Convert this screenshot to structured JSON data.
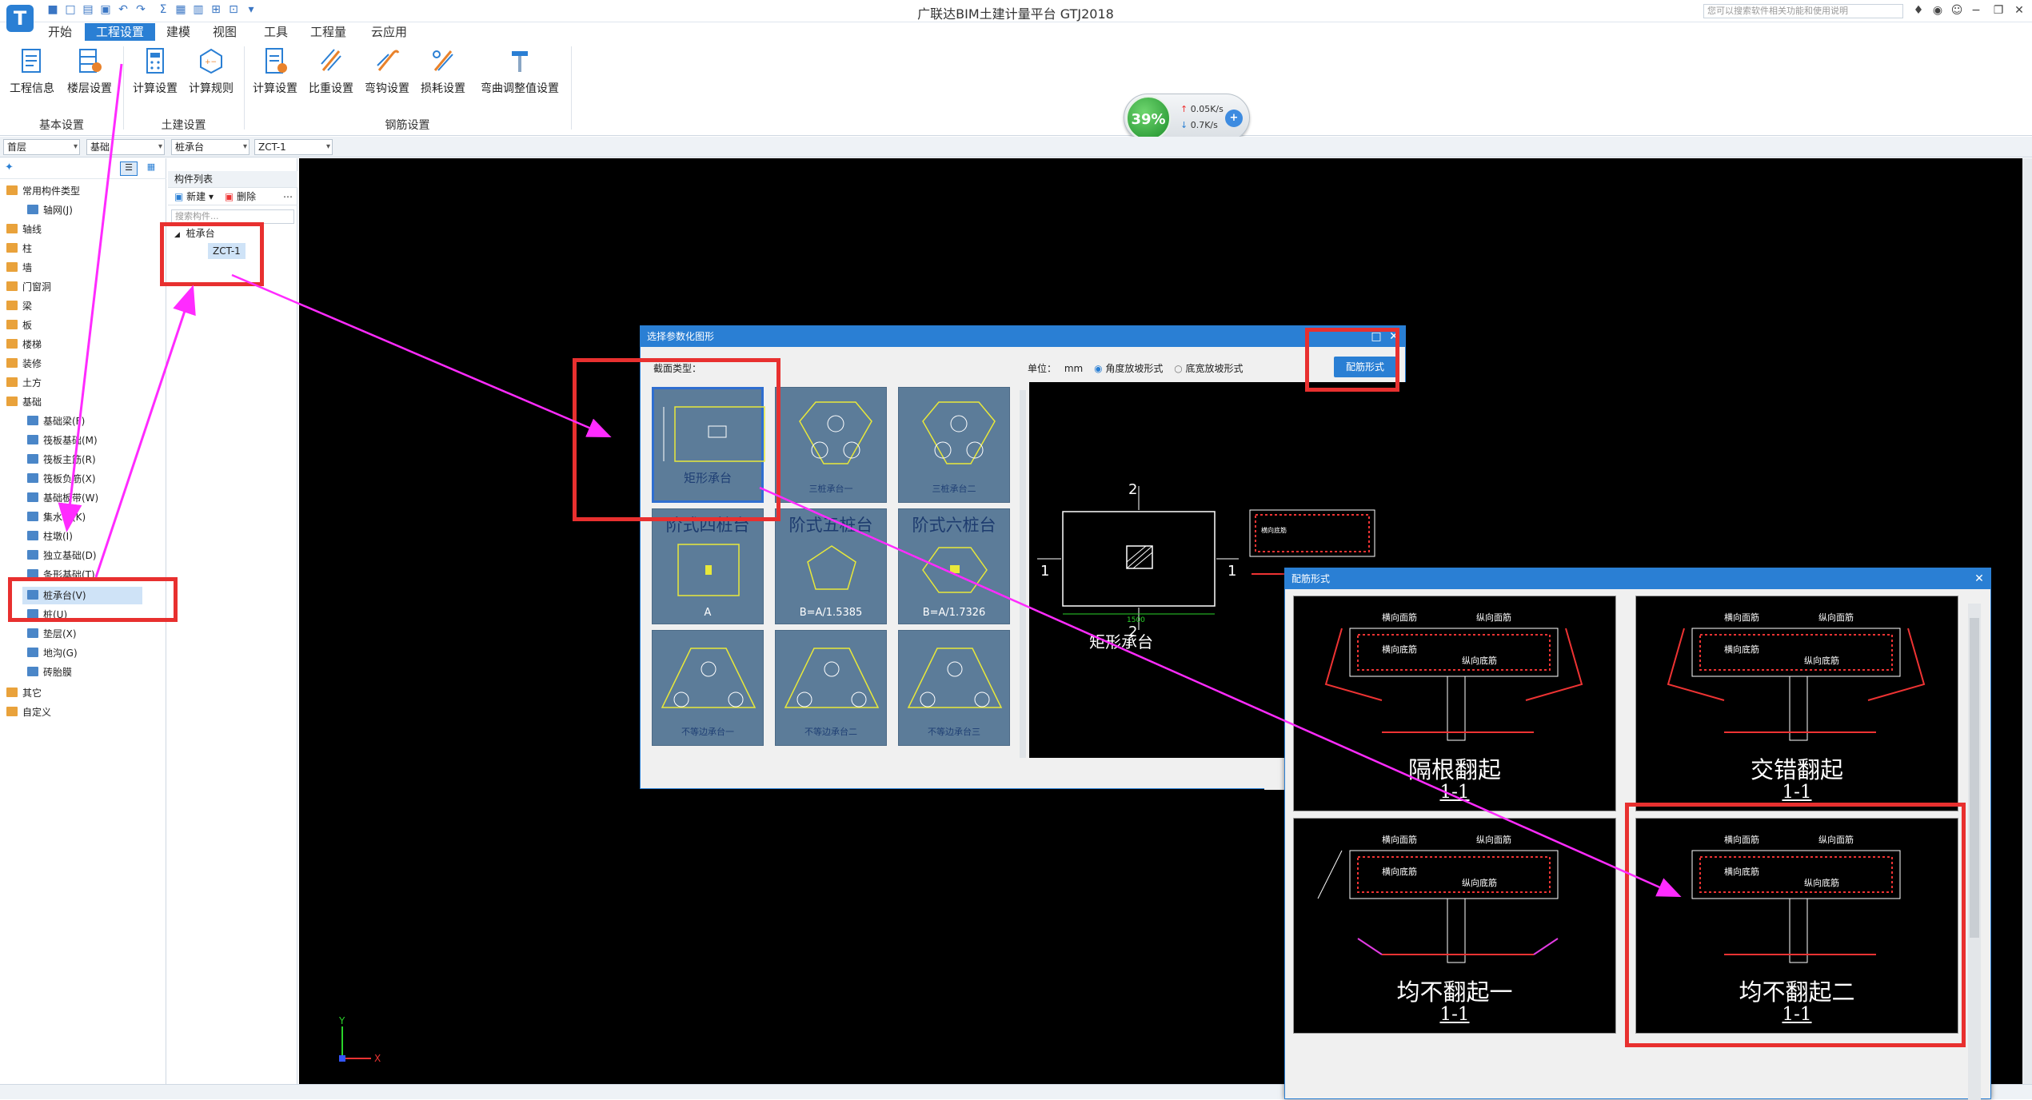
{
  "app": {
    "logo": "T",
    "title": "广联达BIM土建计量平台 GTJ2018",
    "help_search_placeholder": "您可以搜索软件相关功能和使用说明"
  },
  "menu": [
    "开始",
    "工程设置",
    "建模",
    "视图",
    "工具",
    "工程量",
    "云应用"
  ],
  "menu_active": 1,
  "ribbon": {
    "buttons": [
      "工程信息",
      "楼层设置",
      "计算设置",
      "计算规则",
      "计算设置",
      "比重设置",
      "弯钩设置",
      "损耗设置",
      "弯曲调整值设置"
    ],
    "groups": [
      "基本设置",
      "土建设置",
      "钢筋设置"
    ],
    "speed": {
      "percent": "39%",
      "up": "0.05K/s",
      "down": "0.7K/s"
    }
  },
  "combos": {
    "floor": "首层",
    "category": "基础",
    "type": "桩承台",
    "item": "ZCT-1"
  },
  "nav": {
    "items": [
      {
        "label": "常用构件类型",
        "kind": "fold"
      },
      {
        "label": "轴网(J)",
        "kind": "sub"
      },
      {
        "label": "轴线",
        "kind": "fold"
      },
      {
        "label": "柱",
        "kind": "fold"
      },
      {
        "label": "墙",
        "kind": "fold"
      },
      {
        "label": "门窗洞",
        "kind": "fold"
      },
      {
        "label": "梁",
        "kind": "fold"
      },
      {
        "label": "板",
        "kind": "fold"
      },
      {
        "label": "楼梯",
        "kind": "fold"
      },
      {
        "label": "装修",
        "kind": "fold"
      },
      {
        "label": "土方",
        "kind": "fold"
      },
      {
        "label": "基础",
        "kind": "fold"
      },
      {
        "label": "基础梁(F)",
        "kind": "sub"
      },
      {
        "label": "筏板基础(M)",
        "kind": "sub"
      },
      {
        "label": "筏板主筋(R)",
        "kind": "sub"
      },
      {
        "label": "筏板负筋(X)",
        "kind": "sub"
      },
      {
        "label": "基础板带(W)",
        "kind": "sub"
      },
      {
        "label": "集水坑(K)",
        "kind": "sub"
      },
      {
        "label": "柱墩(I)",
        "kind": "sub"
      },
      {
        "label": "独立基础(D)",
        "kind": "sub"
      },
      {
        "label": "条形基础(T)",
        "kind": "sub"
      },
      {
        "label": "桩承台(V)",
        "kind": "sub",
        "selected": true
      },
      {
        "label": "桩(U)",
        "kind": "sub"
      },
      {
        "label": "垫层(X)",
        "kind": "sub"
      },
      {
        "label": "地沟(G)",
        "kind": "sub"
      },
      {
        "label": "砖胎膜",
        "kind": "sub"
      },
      {
        "label": "其它",
        "kind": "fold"
      },
      {
        "label": "自定义",
        "kind": "fold"
      }
    ]
  },
  "comp": {
    "header": "构件列表",
    "new": "新建",
    "delete": "删除",
    "search_placeholder": "搜索构件...",
    "group": "桩承台",
    "item": "ZCT-1"
  },
  "dialog1": {
    "title": "选择参数化图形",
    "section_label": "截面类型：",
    "unit_label": "单位：",
    "unit": "mm",
    "radio1": "角度放坡形式",
    "radio2": "底宽放坡形式",
    "button": "配筋形式",
    "tiles": [
      {
        "name": "矩形承台",
        "big": false
      },
      {
        "name": "三桩承台一",
        "big": false
      },
      {
        "name": "三桩承台二",
        "big": false
      },
      {
        "name": "阶式四桩台",
        "big": true,
        "formula": "A"
      },
      {
        "name": "阶式五桩台",
        "big": true,
        "formula": "B=A/1.5385"
      },
      {
        "name": "阶式六桩台",
        "big": true,
        "formula": "B=A/1.7326"
      },
      {
        "name": "不等边承台一",
        "big": false
      },
      {
        "name": "不等边承台二",
        "big": false
      },
      {
        "name": "不等边承台三",
        "big": false
      }
    ],
    "preview": {
      "caption": "矩形承台",
      "sec2": "2",
      "sec1": "1",
      "dim": "1500"
    }
  },
  "dialog2": {
    "title": "配筋形式",
    "cells": [
      {
        "name": "隔根翻起",
        "sec": "1-1"
      },
      {
        "name": "交错翻起",
        "sec": "1-1"
      },
      {
        "name": "均不翻起一",
        "sec": "1-1"
      },
      {
        "name": "均不翻起二",
        "sec": "1-1"
      }
    ],
    "labels": {
      "top_h": "横向面筋",
      "top_v": "纵向面筋",
      "bot_h": "横向底筋",
      "bot_v": "纵向底筋"
    }
  },
  "axis": {
    "x": "X",
    "y": "Y"
  }
}
